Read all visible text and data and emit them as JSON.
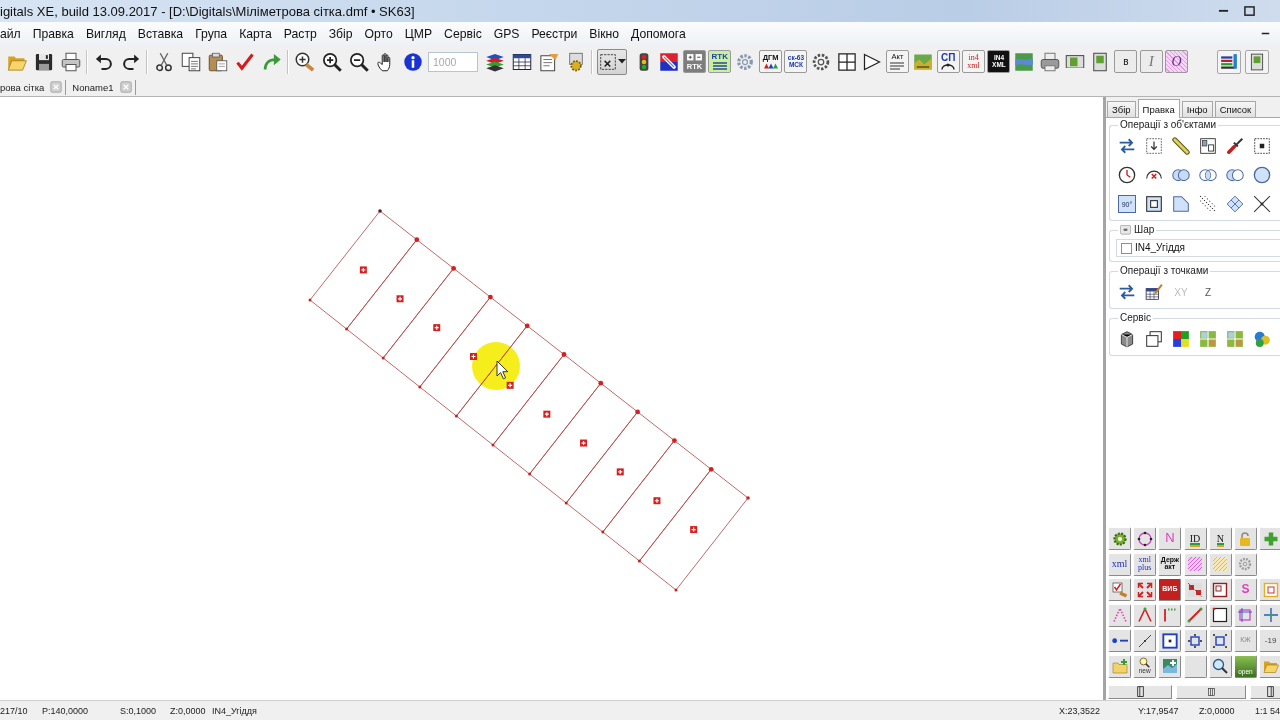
{
  "title_bar": {
    "title": "igitals XE, build 13.09.2017 - [D:\\Digitals\\Міліметрова сітка.dmf • SK63]"
  },
  "menu": [
    "айл",
    "Правка",
    "Вигляд",
    "Вставка",
    "Група",
    "Карта",
    "Растр",
    "Збір",
    "Орто",
    "ЦМР",
    "Сервіс",
    "GPS",
    "Реєстри",
    "Вікно",
    "Допомога"
  ],
  "toolbar": [
    {
      "kind": "button"
    },
    {
      "kind": "button"
    },
    {
      "kind": "button"
    },
    {
      "kind": "separator"
    },
    {
      "kind": "button"
    },
    {
      "kind": "button"
    },
    {
      "kind": "separator"
    },
    {
      "kind": "button"
    },
    {
      "kind": "button"
    },
    {
      "kind": "button"
    },
    {
      "kind": "button"
    },
    {
      "kind": "button"
    },
    {
      "kind": "separator"
    },
    {
      "kind": "button"
    },
    {
      "kind": "button"
    },
    {
      "kind": "button"
    },
    {
      "kind": "button"
    },
    {
      "kind": "button"
    },
    {
      "kind": "field",
      "value": "1000",
      "disabled": true
    },
    {
      "kind": "button"
    },
    {
      "kind": "button"
    },
    {
      "kind": "button"
    },
    {
      "kind": "button"
    },
    {
      "kind": "separator"
    },
    {
      "kind": "dropdown"
    },
    {
      "kind": "button"
    },
    {
      "kind": "button"
    },
    {
      "kind": "text_button",
      "label": "RTK"
    },
    {
      "kind": "text_button",
      "label": "RTK"
    },
    {
      "kind": "button"
    },
    {
      "kind": "text_button",
      "label": "ДГМ"
    },
    {
      "kind": "text_button",
      "label": "ск-63 МСК"
    },
    {
      "kind": "button"
    },
    {
      "kind": "button"
    },
    {
      "kind": "button"
    },
    {
      "kind": "text_button",
      "label": "Акт"
    },
    {
      "kind": "button"
    },
    {
      "kind": "text_button",
      "label": "СП"
    },
    {
      "kind": "text_button",
      "label": "in4 xml"
    },
    {
      "kind": "text_button",
      "label": "IN4 XML"
    },
    {
      "kind": "button"
    },
    {
      "kind": "button"
    },
    {
      "kind": "button"
    },
    {
      "kind": "button"
    },
    {
      "kind": "text_button",
      "label": "в"
    },
    {
      "kind": "text_button",
      "label": "I"
    },
    {
      "kind": "text_button",
      "label": "O"
    }
  ],
  "toolbar_end": [
    {
      "kind": "button"
    },
    {
      "kind": "button"
    }
  ],
  "document_tabs": [
    {
      "label": "рова сітка"
    },
    {
      "label": "Noname1"
    }
  ],
  "side_panel": {
    "tabs": [
      {
        "label": "Збір",
        "selected": false
      },
      {
        "label": "Правка",
        "selected": true
      },
      {
        "label": "Інфо",
        "selected": false
      },
      {
        "label": "Список",
        "selected": false
      }
    ],
    "object_operations": {
      "title": "Операції з об'єктами",
      "buttons": [
        {
          "kind": "icon"
        },
        {
          "kind": "icon"
        },
        {
          "kind": "icon"
        },
        {
          "kind": "icon"
        },
        {
          "kind": "icon"
        },
        {
          "kind": "icon"
        },
        {
          "kind": "icon"
        },
        {
          "kind": "icon"
        },
        {
          "kind": "icon"
        },
        {
          "kind": "icon"
        },
        {
          "kind": "icon"
        },
        {
          "kind": "icon"
        },
        {
          "kind": "text",
          "label": "90°"
        },
        {
          "kind": "icon"
        },
        {
          "kind": "icon"
        },
        {
          "kind": "icon"
        },
        {
          "kind": "icon"
        },
        {
          "kind": "icon"
        }
      ]
    },
    "layer": {
      "title": "Шар",
      "layers": [
        {
          "label": "IN4_Угіддя",
          "checked": false
        }
      ]
    },
    "point_operations": {
      "title": "Операції з точками",
      "buttons": [
        {
          "kind": "icon"
        },
        {
          "kind": "icon"
        },
        {
          "kind": "text",
          "label": "XY",
          "disabled": true
        },
        {
          "kind": "text",
          "label": "Z",
          "disabled": false
        }
      ]
    },
    "service": {
      "title": "Сервіс"
    },
    "tool_grid": [
      [
        {
          "kind": "icon"
        },
        {
          "kind": "icon"
        },
        {
          "kind": "text",
          "label": "N"
        },
        {
          "kind": "text",
          "label": "ID"
        },
        {
          "kind": "text",
          "label": "N"
        },
        {
          "kind": "icon"
        },
        {
          "kind": "icon"
        }
      ],
      [
        {
          "kind": "text",
          "label": "xml"
        },
        {
          "kind": "text",
          "label": "xml plus"
        },
        {
          "kind": "text",
          "label": "Держ акт"
        },
        {
          "kind": "icon"
        },
        {
          "kind": "icon"
        },
        {
          "kind": "icon"
        }
      ],
      [
        {
          "kind": "icon"
        },
        {
          "kind": "icon"
        },
        {
          "kind": "text",
          "label": "ВИБ"
        },
        {
          "kind": "icon"
        },
        {
          "kind": "icon"
        },
        {
          "kind": "text",
          "label": "S"
        },
        {
          "kind": "icon"
        }
      ],
      [
        {
          "kind": "icon"
        },
        {
          "kind": "icon"
        },
        {
          "kind": "icon"
        },
        {
          "kind": "icon"
        },
        {
          "kind": "icon"
        },
        {
          "kind": "icon"
        },
        {
          "kind": "icon"
        }
      ],
      [
        {
          "kind": "icon"
        },
        {
          "kind": "icon"
        },
        {
          "kind": "icon"
        },
        {
          "kind": "icon"
        },
        {
          "kind": "icon"
        },
        {
          "kind": "text",
          "label": "КЖ"
        },
        {
          "kind": "text",
          "label": "-19"
        }
      ],
      [
        {
          "kind": "icon"
        },
        {
          "kind": "text",
          "label": "new"
        },
        {
          "kind": "icon"
        },
        {
          "kind": "blank"
        },
        {
          "kind": "icon"
        },
        {
          "kind": "text",
          "label": "open"
        },
        {
          "kind": "icon"
        }
      ]
    ]
  },
  "status_bar": {
    "left": [
      "217/10",
      "P:140,0000",
      "S:0,1000",
      "Z:0,0000",
      "IN4_Угіддя"
    ],
    "right": [
      "X:23,3522",
      "Y:17,9547",
      "Z:0,0000",
      "1:1 54"
    ]
  }
}
